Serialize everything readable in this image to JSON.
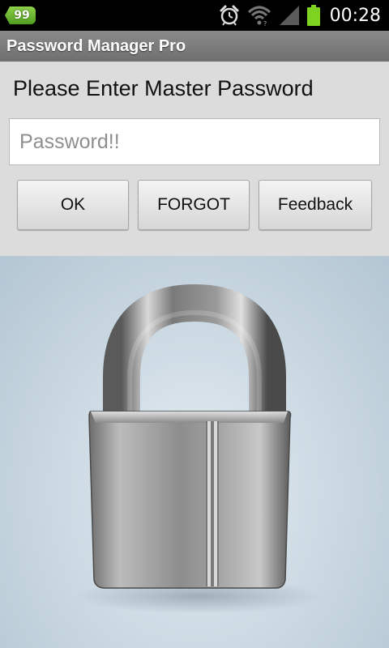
{
  "status_bar": {
    "notification_count": "99",
    "time": "00:28",
    "icons": [
      "alarm-clock-icon",
      "wifi-icon",
      "signal-icon",
      "battery-icon"
    ],
    "battery_color": "#7ed321"
  },
  "app": {
    "title": "Password Manager Pro"
  },
  "login": {
    "prompt": "Please Enter Master Password",
    "password_placeholder": "Password!!",
    "password_value": ""
  },
  "buttons": {
    "ok": "OK",
    "forgot": "FORGOT",
    "feedback": "Feedback"
  },
  "illustration": {
    "icon": "padlock-icon"
  }
}
